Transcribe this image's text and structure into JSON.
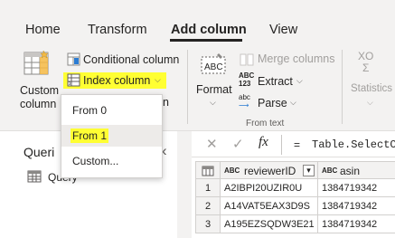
{
  "tabs": [
    {
      "label": "Home",
      "active": false
    },
    {
      "label": "Transform",
      "active": false
    },
    {
      "label": "Add column",
      "active": true
    },
    {
      "label": "View",
      "active": false
    }
  ],
  "ribbon": {
    "custom_column": {
      "line1": "Custom",
      "line2": "column"
    },
    "conditional_column": "Conditional column",
    "index_column": "Index column",
    "duplicate_column_fragment": "n",
    "format": "Format",
    "merge_columns": "Merge columns",
    "extract": "Extract",
    "parse": "Parse",
    "from_text_group": "From text",
    "statistics": "Statistics",
    "extract_icon_text": {
      "top": "ABC",
      "bottom": "123"
    },
    "parse_icon_text": "abc",
    "stats_icon_text": {
      "top": "XO",
      "bottom": "Σ"
    }
  },
  "index_menu": {
    "items": [
      {
        "label": "From 0",
        "highlighted": false,
        "hover": false
      },
      {
        "label": "From 1",
        "highlighted": true,
        "hover": true
      },
      {
        "label": "Custom...",
        "highlighted": false,
        "hover": false
      }
    ]
  },
  "queries_pane": {
    "title": "Queri",
    "collapse_glyph": "‹",
    "items": [
      {
        "label": "Query"
      }
    ]
  },
  "formula_bar": {
    "cancel_glyph": "✕",
    "commit_glyph": "✓",
    "fx_label": "fx",
    "equals": "=",
    "formula": "Table.SelectCo"
  },
  "grid": {
    "columns": [
      {
        "type_icon": "ABC",
        "name": "reviewerID",
        "filter_glyph": "▾"
      },
      {
        "type_icon": "ABC",
        "name": "asin"
      }
    ],
    "rows": [
      {
        "num": "1",
        "reviewerID": "A2IBPI20UZIR0U",
        "asin": "1384719342"
      },
      {
        "num": "2",
        "reviewerID": "A14VAT5EAX3D9S",
        "asin": "1384719342"
      },
      {
        "num": "3",
        "reviewerID": "A195EZSQDW3E21",
        "asin": "1384719342"
      }
    ]
  },
  "colors": {
    "highlight": "#ffff33",
    "ribbon_bg": "#f3f2f1",
    "icon_green": "#6b9e3a",
    "icon_blue": "#2b7cd3",
    "menu_hover": "#edebe9"
  }
}
